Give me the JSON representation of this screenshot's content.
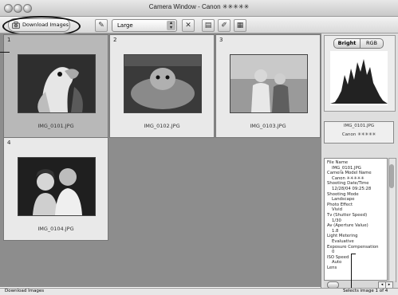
{
  "window": {
    "title": "Camera Window - Canon ✳✳✳✳✳"
  },
  "toolbar": {
    "download_label": "Download Images",
    "size_value": "Large"
  },
  "thumbnails": [
    {
      "number": "1",
      "filename": "IMG_0101.JPG",
      "selected": true
    },
    {
      "number": "2",
      "filename": "IMG_0102.JPG",
      "selected": false
    },
    {
      "number": "3",
      "filename": "IMG_0103.JPG",
      "selected": false
    },
    {
      "number": "4",
      "filename": "IMG_0104.JPG",
      "selected": false
    }
  ],
  "panel": {
    "tab_bright": "Bright",
    "tab_rgb": "RGB",
    "camera_file": "IMG_0101.JPG",
    "camera_model": "Canon ✳✳✳✳✳",
    "info": [
      {
        "label": "File Name",
        "value": "IMG_0101.JPG"
      },
      {
        "label": "Camera Model Name",
        "value": "Canon ✳✳✳✳✳"
      },
      {
        "label": "Shooting Date/Time",
        "value": "12/28/04 09:25:28"
      },
      {
        "label": "Shooting Mode",
        "value": "Landscape"
      },
      {
        "label": "Photo Effect",
        "value": "Vivid"
      },
      {
        "label": "Tv (Shutter Speed)",
        "value": "1/30"
      },
      {
        "label": "Av (Aperture Value)",
        "value": "1.8"
      },
      {
        "label": "Light Metering",
        "value": "Evaluative"
      },
      {
        "label": "Exposure Compensation",
        "value": "0"
      },
      {
        "label": "ISO Speed",
        "value": "Auto"
      },
      {
        "label": "Lens",
        "value": ""
      }
    ]
  },
  "status": {
    "left": "Download Images",
    "right": "Selects image 1 of 4"
  },
  "colors": {
    "grid_bg": "#8d8d8d",
    "selected_thumb": "#b8b8b8"
  }
}
